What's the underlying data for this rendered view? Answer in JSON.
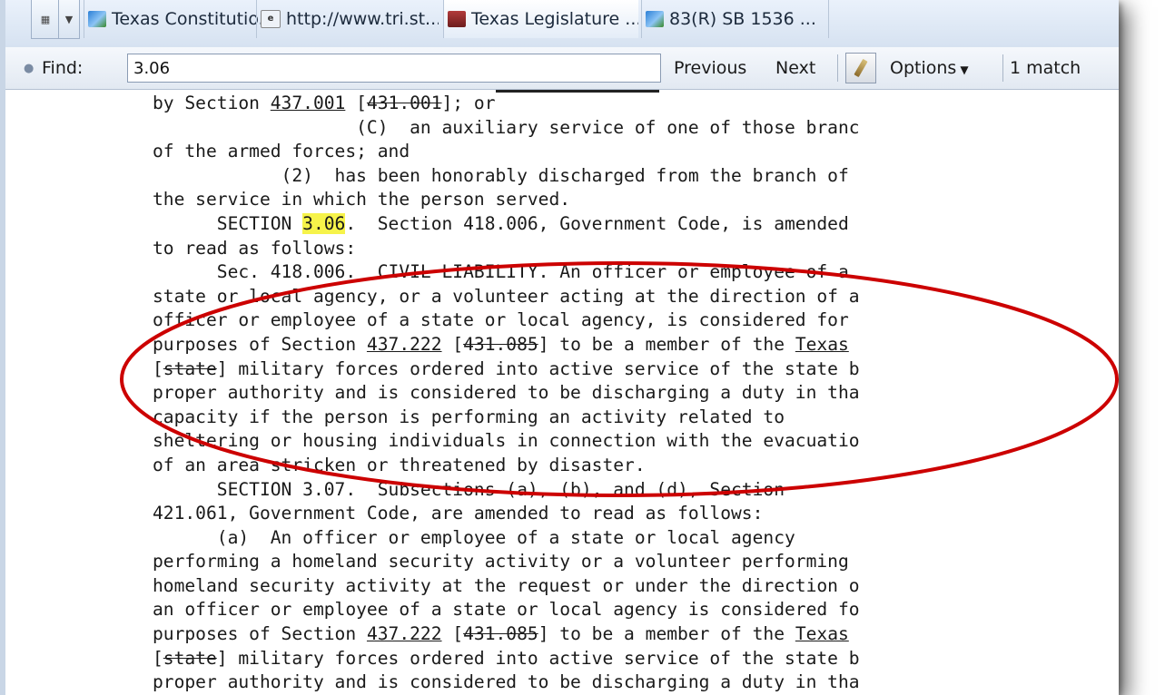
{
  "tabs": [
    {
      "title": "Texas Constitutio...",
      "icon": "texas-flag-icon"
    },
    {
      "title": "http://www.tri.st...",
      "icon": "ie-page-icon"
    },
    {
      "title": "Texas Legislature ...",
      "icon": "legislature-icon"
    },
    {
      "title": "83(R) SB 1536 ...",
      "icon": "texas-flag-icon"
    }
  ],
  "find": {
    "label": "Find:",
    "value": "3.06",
    "previous": "Previous",
    "next": "Next",
    "options": "Options",
    "matches": "1 match"
  },
  "document": {
    "lines": [
      [
        {
          "t": "by Section "
        },
        {
          "t": "437.001",
          "f": "u"
        },
        {
          "t": " ["
        },
        {
          "t": "431.001",
          "f": "s"
        },
        {
          "t": "]; or"
        }
      ],
      [
        {
          "t": "                   (C)  an auxiliary service of one of those branc"
        }
      ],
      [
        {
          "t": "of the armed forces; and"
        }
      ],
      [
        {
          "t": "            (2)  has been honorably discharged from the branch of"
        }
      ],
      [
        {
          "t": "the service in which the person served."
        }
      ],
      [
        {
          "t": "      SECTION "
        },
        {
          "t": "3.06",
          "f": "hit"
        },
        {
          "t": ".  Section 418.006, Government Code, is amended"
        }
      ],
      [
        {
          "t": "to read as follows:"
        }
      ],
      [
        {
          "t": "      Sec. 418.006.  CIVIL LIABILITY. An officer or employee of a"
        }
      ],
      [
        {
          "t": "state or local agency, or a volunteer acting at the direction of a"
        }
      ],
      [
        {
          "t": "officer or employee of a state or local agency, is considered for"
        }
      ],
      [
        {
          "t": "purposes of Section "
        },
        {
          "t": "437.222",
          "f": "u"
        },
        {
          "t": " ["
        },
        {
          "t": "431.085",
          "f": "s"
        },
        {
          "t": "] to be a member of the "
        },
        {
          "t": "Texas",
          "f": "u"
        }
      ],
      [
        {
          "t": "["
        },
        {
          "t": "state",
          "f": "s"
        },
        {
          "t": "] military forces ordered into active service of the state b"
        }
      ],
      [
        {
          "t": "proper authority and is considered to be discharging a duty in tha"
        }
      ],
      [
        {
          "t": "capacity if the person is performing an activity related to"
        }
      ],
      [
        {
          "t": "sheltering or housing individuals in connection with the evacuatio"
        }
      ],
      [
        {
          "t": "of an area stricken or threatened by disaster."
        }
      ],
      [
        {
          "t": "      SECTION 3.07.  Subsections (a), (b), and (d), Section"
        }
      ],
      [
        {
          "t": "421.061, Government Code, are amended to read as follows:"
        }
      ],
      [
        {
          "t": "      (a)  An officer or employee of a state or local agency"
        }
      ],
      [
        {
          "t": "performing a homeland security activity or a volunteer performing"
        }
      ],
      [
        {
          "t": "homeland security activity at the request or under the direction o"
        }
      ],
      [
        {
          "t": "an officer or employee of a state or local agency is considered fo"
        }
      ],
      [
        {
          "t": "purposes of Section "
        },
        {
          "t": "437.222",
          "f": "u"
        },
        {
          "t": " ["
        },
        {
          "t": "431.085",
          "f": "s"
        },
        {
          "t": "] to be a member of the "
        },
        {
          "t": "Texas",
          "f": "u"
        }
      ],
      [
        {
          "t": "["
        },
        {
          "t": "state",
          "f": "s"
        },
        {
          "t": "] military forces ordered into active service of the state b"
        }
      ],
      [
        {
          "t": "proper authority and is considered to be discharging a duty in tha"
        }
      ]
    ]
  },
  "colors": {
    "annotation": "#cc0000",
    "highlight": "#f6f34a"
  }
}
